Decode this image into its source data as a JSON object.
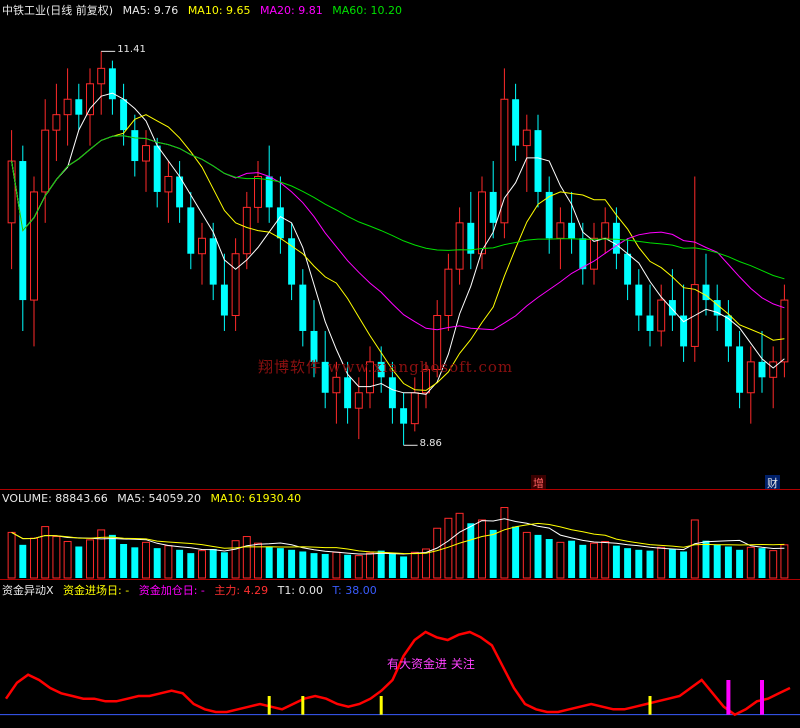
{
  "price_header": {
    "title": "中铁工业(日线 前复权)",
    "ma5": "MA5: 9.76",
    "ma10": "MA10: 9.65",
    "ma20": "MA20: 9.81",
    "ma60": "MA60: 10.20"
  },
  "price_annotations": {
    "high": "11.41",
    "low": "8.86"
  },
  "watermark": "翔博软件 www.xiangbosoft.com",
  "badges": {
    "zeng": "增",
    "cai": "财"
  },
  "volume_header": {
    "volume": "VOLUME: 88843.66",
    "ma5": "MA5: 54059.20",
    "ma10": "MA10: 61930.40"
  },
  "indicator_header": {
    "name": "资金异动X",
    "entry": "资金进场日: -",
    "add": "资金加仓日: -",
    "main": "主力: 4.29",
    "t1": "T1: 0.00",
    "t": "T: 38.00"
  },
  "indicator_signal": "有大资金进 关注",
  "colors": {
    "bull": "#ff2a2a",
    "bear": "#00ffff",
    "ma5": "#ffffff",
    "ma10": "#ffff00",
    "ma20": "#ff00ff",
    "ma60": "#00e000",
    "main_line": "#ff0000",
    "baseline": "#3a5cff"
  },
  "chart_data": {
    "type": "candlestick",
    "candles": [
      [
        10.3,
        10.9,
        10.0,
        10.7
      ],
      [
        10.7,
        10.8,
        9.6,
        9.8
      ],
      [
        9.8,
        10.6,
        9.5,
        10.5
      ],
      [
        10.5,
        11.1,
        10.3,
        10.9
      ],
      [
        10.9,
        11.2,
        10.7,
        11.0
      ],
      [
        11.0,
        11.3,
        10.8,
        11.1
      ],
      [
        11.1,
        11.2,
        10.9,
        11.0
      ],
      [
        11.0,
        11.3,
        10.8,
        11.2
      ],
      [
        11.2,
        11.41,
        11.0,
        11.3
      ],
      [
        11.3,
        11.35,
        11.0,
        11.1
      ],
      [
        11.1,
        11.2,
        10.8,
        10.9
      ],
      [
        10.9,
        11.0,
        10.6,
        10.7
      ],
      [
        10.7,
        10.9,
        10.5,
        10.8
      ],
      [
        10.8,
        10.85,
        10.4,
        10.5
      ],
      [
        10.5,
        10.7,
        10.3,
        10.6
      ],
      [
        10.6,
        10.7,
        10.3,
        10.4
      ],
      [
        10.4,
        10.5,
        10.0,
        10.1
      ],
      [
        10.1,
        10.3,
        9.9,
        10.2
      ],
      [
        10.2,
        10.3,
        9.8,
        9.9
      ],
      [
        9.9,
        10.1,
        9.6,
        9.7
      ],
      [
        9.7,
        10.2,
        9.6,
        10.1
      ],
      [
        10.1,
        10.5,
        10.0,
        10.4
      ],
      [
        10.4,
        10.7,
        10.3,
        10.6
      ],
      [
        10.6,
        10.8,
        10.3,
        10.4
      ],
      [
        10.4,
        10.6,
        10.1,
        10.2
      ],
      [
        10.2,
        10.3,
        9.8,
        9.9
      ],
      [
        9.9,
        10.0,
        9.5,
        9.6
      ],
      [
        9.6,
        9.8,
        9.3,
        9.4
      ],
      [
        9.4,
        9.6,
        9.1,
        9.2
      ],
      [
        9.2,
        9.4,
        9.0,
        9.3
      ],
      [
        9.3,
        9.4,
        9.0,
        9.1
      ],
      [
        9.1,
        9.3,
        8.9,
        9.2
      ],
      [
        9.2,
        9.5,
        9.1,
        9.4
      ],
      [
        9.4,
        9.5,
        9.2,
        9.3
      ],
      [
        9.3,
        9.4,
        9.0,
        9.1
      ],
      [
        9.1,
        9.2,
        8.86,
        9.0
      ],
      [
        9.0,
        9.3,
        8.95,
        9.2
      ],
      [
        9.2,
        9.4,
        9.1,
        9.35
      ],
      [
        9.35,
        9.8,
        9.3,
        9.7
      ],
      [
        9.7,
        10.1,
        9.6,
        10.0
      ],
      [
        10.0,
        10.4,
        9.9,
        10.3
      ],
      [
        10.3,
        10.5,
        10.0,
        10.1
      ],
      [
        10.1,
        10.6,
        10.0,
        10.5
      ],
      [
        10.5,
        10.7,
        10.2,
        10.3
      ],
      [
        10.3,
        11.3,
        10.2,
        11.1
      ],
      [
        11.1,
        11.2,
        10.7,
        10.8
      ],
      [
        10.8,
        11.0,
        10.5,
        10.9
      ],
      [
        10.9,
        11.0,
        10.4,
        10.5
      ],
      [
        10.5,
        10.6,
        10.1,
        10.2
      ],
      [
        10.2,
        10.4,
        10.0,
        10.3
      ],
      [
        10.3,
        10.5,
        10.1,
        10.2
      ],
      [
        10.2,
        10.3,
        9.9,
        10.0
      ],
      [
        10.0,
        10.3,
        9.9,
        10.2
      ],
      [
        10.2,
        10.4,
        10.1,
        10.3
      ],
      [
        10.3,
        10.4,
        10.0,
        10.1
      ],
      [
        10.1,
        10.2,
        9.8,
        9.9
      ],
      [
        9.9,
        10.0,
        9.6,
        9.7
      ],
      [
        9.7,
        9.9,
        9.5,
        9.6
      ],
      [
        9.6,
        9.9,
        9.5,
        9.8
      ],
      [
        9.8,
        10.0,
        9.6,
        9.7
      ],
      [
        9.7,
        9.9,
        9.4,
        9.5
      ],
      [
        9.5,
        10.6,
        9.4,
        9.9
      ],
      [
        9.9,
        10.1,
        9.7,
        9.8
      ],
      [
        9.8,
        9.9,
        9.6,
        9.7
      ],
      [
        9.7,
        9.8,
        9.4,
        9.5
      ],
      [
        9.5,
        9.6,
        9.1,
        9.2
      ],
      [
        9.2,
        9.5,
        9.0,
        9.4
      ],
      [
        9.4,
        9.6,
        9.2,
        9.3
      ],
      [
        9.3,
        9.5,
        9.1,
        9.4
      ],
      [
        9.4,
        9.9,
        9.3,
        9.8
      ]
    ],
    "ma_series": [
      "MA5",
      "MA10",
      "MA20",
      "MA60"
    ],
    "volume": [
      55,
      40,
      48,
      62,
      50,
      44,
      38,
      46,
      58,
      52,
      41,
      37,
      43,
      36,
      39,
      34,
      30,
      33,
      35,
      31,
      45,
      50,
      42,
      38,
      36,
      34,
      32,
      30,
      29,
      31,
      28,
      27,
      30,
      33,
      29,
      26,
      31,
      35,
      60,
      72,
      78,
      66,
      70,
      58,
      85,
      62,
      55,
      52,
      47,
      43,
      45,
      40,
      42,
      44,
      39,
      36,
      34,
      33,
      37,
      35,
      32,
      70,
      45,
      40,
      38,
      34,
      37,
      36,
      33,
      40
    ],
    "indicator": {
      "main_line": [
        8,
        14,
        17,
        15,
        12,
        10,
        9,
        8,
        8,
        7,
        7,
        8,
        9,
        9,
        10,
        11,
        10,
        6,
        4,
        3,
        3,
        4,
        5,
        6,
        5,
        4,
        6,
        8,
        9,
        8,
        6,
        5,
        6,
        8,
        11,
        15,
        24,
        30,
        33,
        31,
        30,
        32,
        33,
        31,
        28,
        20,
        12,
        6,
        4,
        3,
        3,
        4,
        5,
        6,
        5,
        4,
        4,
        5,
        6,
        7,
        8,
        9,
        12,
        15,
        10,
        5,
        2,
        4,
        7,
        8,
        10,
        12
      ],
      "entry_markers": [
        23,
        26,
        33,
        57
      ],
      "add_markers": [
        64,
        67
      ]
    }
  }
}
